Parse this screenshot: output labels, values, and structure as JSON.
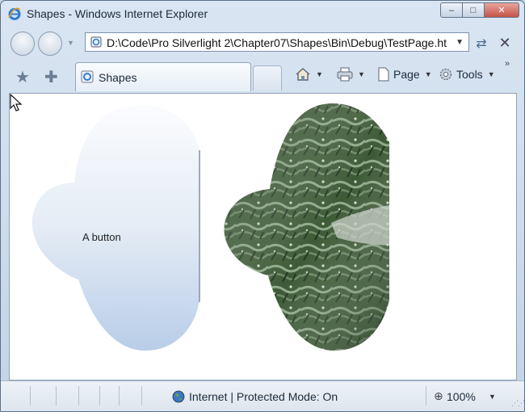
{
  "window": {
    "title": "Shapes - Windows Internet Explorer",
    "minimize_symbol": "–",
    "maximize_symbol": "□",
    "close_symbol": "✕"
  },
  "address": {
    "url": "D:\\Code\\Pro Silverlight 2\\Chapter07\\Shapes\\Bin\\Debug\\TestPage.ht"
  },
  "tabs": [
    {
      "label": "Shapes",
      "icon": "ie-page-icon"
    }
  ],
  "commands": {
    "home_icon": "home-icon",
    "print_icon": "print-icon",
    "page_label": "Page",
    "tools_label": "Tools",
    "more_symbol": "»"
  },
  "content": {
    "button_label": "A button"
  },
  "status": {
    "zone_text": "Internet | Protected Mode: On",
    "zoom_text": "100%"
  },
  "colors": {
    "ie_blue": "#2d7bd6",
    "shape_top": "#f6f9fc",
    "shape_bottom": "#b9cde8",
    "photo_dark": "#2f4a2a",
    "photo_light": "#8fa88a"
  }
}
